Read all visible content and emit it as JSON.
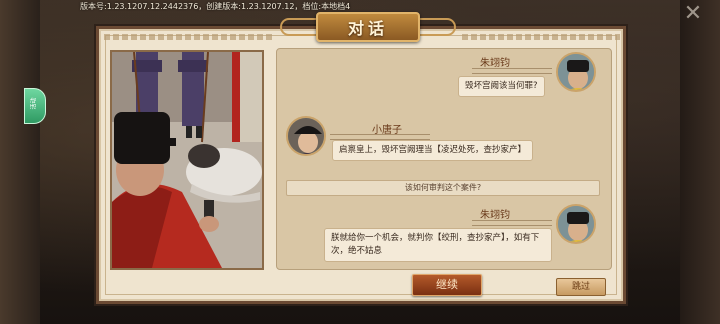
{
  "header": {
    "version_info": "版本号:1.23.1207.12.2442376，创建版本:1.23.1207.12，档位:本地档4",
    "side_tab_label": "活动"
  },
  "dialog": {
    "title": "对话",
    "messages": [
      {
        "speaker": "朱翊钧",
        "side": "right",
        "text": "毁坏宫阙该当何罪?"
      },
      {
        "speaker": "小唐子",
        "side": "left",
        "text": "启禀皇上，毁坏宫阙理当【凌迟处死，查抄家产】"
      },
      {
        "speaker": "",
        "side": "center",
        "text": "该如何审判这个案件?"
      },
      {
        "speaker": "朱翊钧",
        "side": "right",
        "text": "朕就给你一个机会，就判你【绞刑，查抄家产】，如有下次，绝不姑息"
      }
    ],
    "continue_label": "继续",
    "skip_label": "跳过"
  },
  "colors": {
    "frame": "#6b4a33",
    "panel": "#d9c6a5",
    "bubble": "#f4ead8",
    "continue_button": "#9a4420",
    "skip_button": "#d8b07c"
  },
  "icons": {
    "close": "close-icon",
    "emperor_avatar": "emperor-avatar",
    "eunuch_avatar": "eunuch-avatar"
  }
}
